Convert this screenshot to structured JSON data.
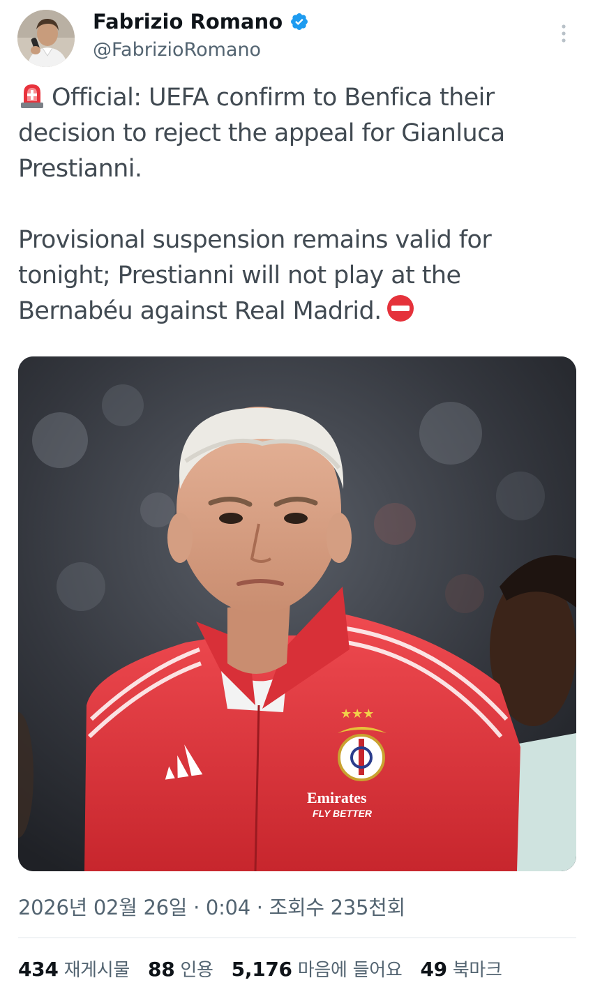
{
  "author": {
    "display_name": "Fabrizio Romano",
    "handle": "@FabrizioRomano",
    "avatar_icon": "profile-photo",
    "verified_icon": "verified-badge-icon"
  },
  "tweet": {
    "line1_lead_icon": "rotating-light-icon",
    "paragraph1": "Official: UEFA confirm to Benfica their decision to reject the appeal for Gianluca Prestianni.",
    "paragraph2": "Provisional suspension remains valid for tonight; Prestianni will not play at the Bernabéu against Real Madrid.",
    "trailing_icon": "no-entry-icon"
  },
  "media": {
    "kind": "photo",
    "shirt_sponsor_line1": "Emirates",
    "shirt_sponsor_line2": "FLY BETTER"
  },
  "meta": {
    "text": "2026년 02월 26일 · 0:04 · 조회수 235천회"
  },
  "stats": [
    {
      "count": "434",
      "label": "재게시물"
    },
    {
      "count": "88",
      "label": "인용"
    },
    {
      "count": "5,176",
      "label": "마음에 들어요"
    },
    {
      "count": "49",
      "label": "북마크"
    }
  ],
  "colors": {
    "text_primary": "#0f1419",
    "text_secondary": "#536471",
    "verified_blue": "#1d9bf0",
    "benfica_red": "#e0383f"
  }
}
